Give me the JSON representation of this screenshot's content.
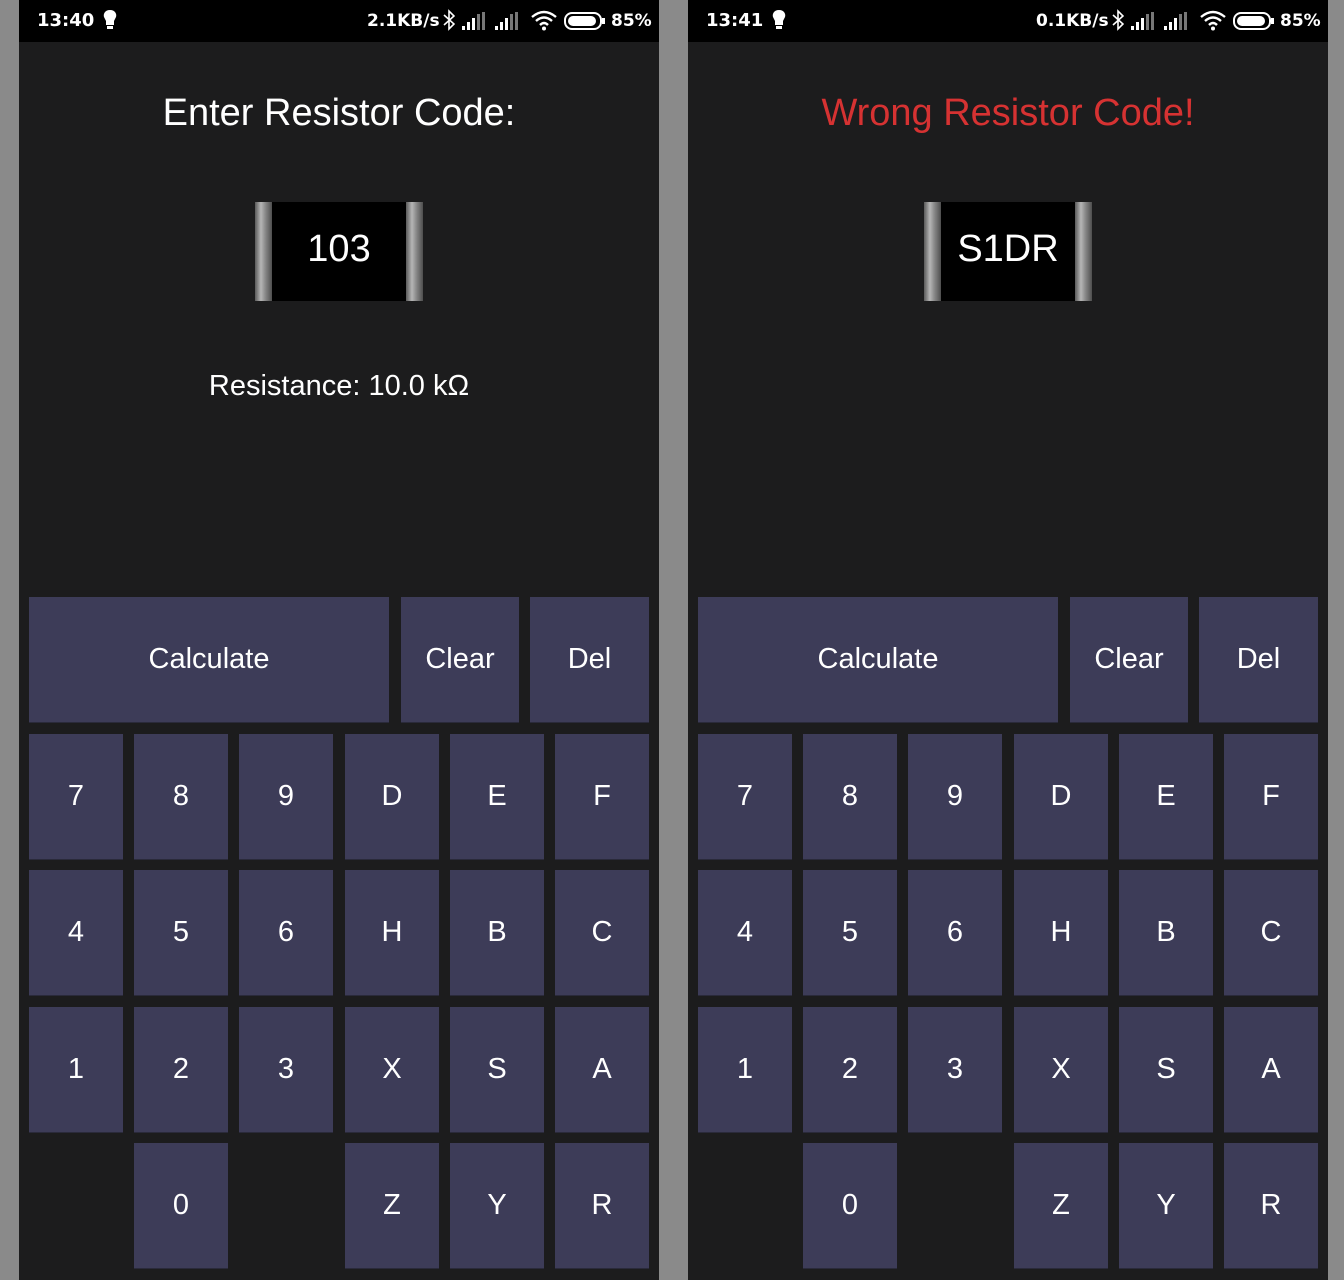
{
  "screens": [
    {
      "status": {
        "time": "13:40",
        "speed": "2.1KB/s",
        "battery": "85%"
      },
      "prompt": "Enter Resistor Code:",
      "chip_code": "103",
      "result": "Resistance: 10.0 kΩ"
    },
    {
      "status": {
        "time": "13:41",
        "speed": "0.1KB/s",
        "battery": "85%"
      },
      "prompt": "Wrong Resistor Code!",
      "chip_code": "S1DR",
      "result": ""
    }
  ],
  "keypad": {
    "actions": {
      "calculate": "Calculate",
      "clear": "Clear",
      "del": "Del"
    },
    "rows": [
      [
        "7",
        "8",
        "9",
        "D",
        "E",
        "F"
      ],
      [
        "4",
        "5",
        "6",
        "H",
        "B",
        "C"
      ],
      [
        "1",
        "2",
        "3",
        "X",
        "S",
        "A"
      ],
      [
        "",
        "0",
        "",
        "Z",
        "Y",
        "R"
      ]
    ]
  },
  "colors": {
    "background": "#1c1c1d",
    "key": "#3d3c58",
    "error": "#d63232",
    "text": "#ffffff"
  }
}
